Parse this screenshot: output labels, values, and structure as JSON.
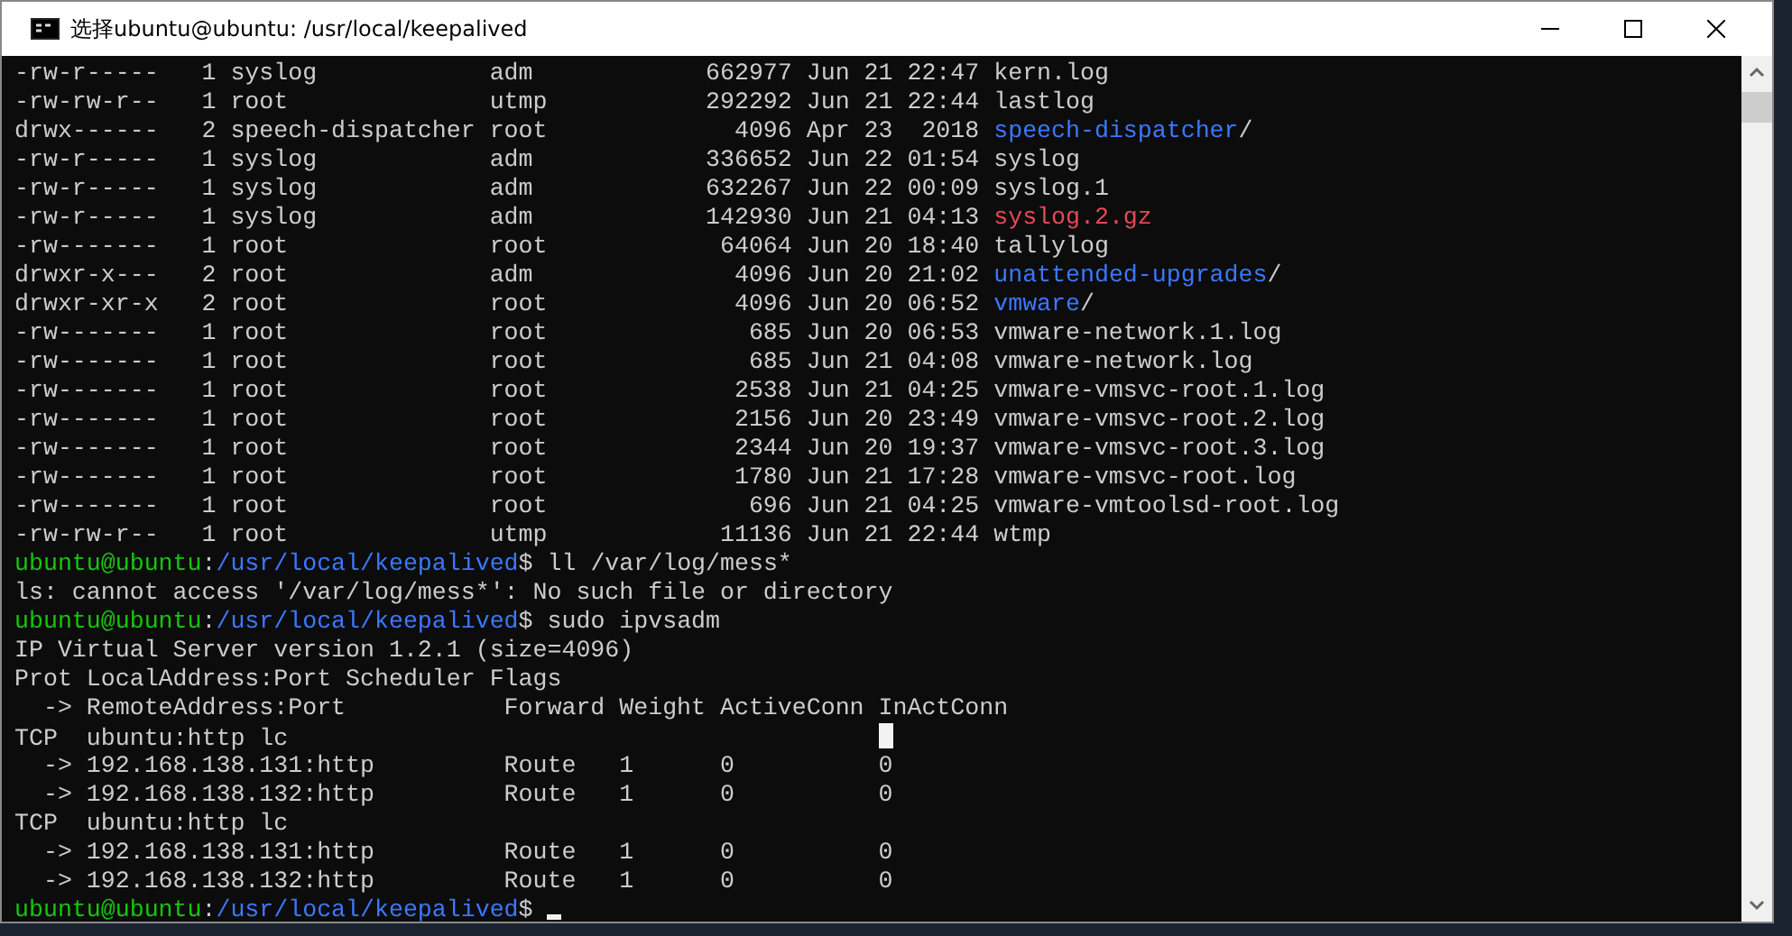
{
  "window": {
    "title": "选择ubuntu@ubuntu: /usr/local/keepalived"
  },
  "lines": [
    [
      {
        "kind": "plain",
        "text": "-rw-r-----   1 syslog            adm            662977 Jun 21 22:47 "
      },
      {
        "kind": "plain",
        "text": "kern.log"
      }
    ],
    [
      {
        "kind": "plain",
        "text": "-rw-rw-r--   1 root              utmp           292292 Jun 21 22:44 "
      },
      {
        "kind": "plain",
        "text": "lastlog"
      }
    ],
    [
      {
        "kind": "plain",
        "text": "drwx------   2 speech-dispatcher root             4096 Apr 23  2018 "
      },
      {
        "kind": "dir",
        "text": "speech-dispatcher"
      },
      {
        "kind": "plain",
        "text": "/"
      }
    ],
    [
      {
        "kind": "plain",
        "text": "-rw-r-----   1 syslog            adm            336652 Jun 22 01:54 "
      },
      {
        "kind": "plain",
        "text": "syslog"
      }
    ],
    [
      {
        "kind": "plain",
        "text": "-rw-r-----   1 syslog            adm            632267 Jun 22 00:09 "
      },
      {
        "kind": "plain",
        "text": "syslog.1"
      }
    ],
    [
      {
        "kind": "plain",
        "text": "-rw-r-----   1 syslog            adm            142930 Jun 21 04:13 "
      },
      {
        "kind": "archive",
        "text": "syslog.2.gz"
      }
    ],
    [
      {
        "kind": "plain",
        "text": "-rw-------   1 root              root            64064 Jun 20 18:40 "
      },
      {
        "kind": "plain",
        "text": "tallylog"
      }
    ],
    [
      {
        "kind": "plain",
        "text": "drwxr-x---   2 root              adm              4096 Jun 20 21:02 "
      },
      {
        "kind": "dir",
        "text": "unattended-upgrades"
      },
      {
        "kind": "plain",
        "text": "/"
      }
    ],
    [
      {
        "kind": "plain",
        "text": "drwxr-xr-x   2 root              root             4096 Jun 20 06:52 "
      },
      {
        "kind": "dir",
        "text": "vmware"
      },
      {
        "kind": "plain",
        "text": "/"
      }
    ],
    [
      {
        "kind": "plain",
        "text": "-rw-------   1 root              root              685 Jun 20 06:53 vmware-network.1.log"
      }
    ],
    [
      {
        "kind": "plain",
        "text": "-rw-------   1 root              root              685 Jun 21 04:08 vmware-network.log"
      }
    ],
    [
      {
        "kind": "plain",
        "text": "-rw-------   1 root              root             2538 Jun 21 04:25 vmware-vmsvc-root.1.log"
      }
    ],
    [
      {
        "kind": "plain",
        "text": "-rw-------   1 root              root             2156 Jun 20 23:49 vmware-vmsvc-root.2.log"
      }
    ],
    [
      {
        "kind": "plain",
        "text": "-rw-------   1 root              root             2344 Jun 20 19:37 vmware-vmsvc-root.3.log"
      }
    ],
    [
      {
        "kind": "plain",
        "text": "-rw-------   1 root              root             1780 Jun 21 17:28 vmware-vmsvc-root.log"
      }
    ],
    [
      {
        "kind": "plain",
        "text": "-rw-------   1 root              root              696 Jun 21 04:25 vmware-vmtoolsd-root.log"
      }
    ],
    [
      {
        "kind": "plain",
        "text": "-rw-rw-r--   1 root              utmp            11136 Jun 21 22:44 wtmp"
      }
    ],
    [
      {
        "kind": "user",
        "text": "ubuntu@ubuntu"
      },
      {
        "kind": "plain",
        "text": ":"
      },
      {
        "kind": "path",
        "text": "/usr/local/keepalived"
      },
      {
        "kind": "plain",
        "text": "$ ll /var/log/mess*"
      }
    ],
    [
      {
        "kind": "plain",
        "text": "ls: cannot access '/var/log/mess*': No such file or directory"
      }
    ],
    [
      {
        "kind": "user",
        "text": "ubuntu@ubuntu"
      },
      {
        "kind": "plain",
        "text": ":"
      },
      {
        "kind": "path",
        "text": "/usr/local/keepalived"
      },
      {
        "kind": "plain",
        "text": "$ sudo ipvsadm"
      }
    ],
    [
      {
        "kind": "plain",
        "text": "IP Virtual Server version 1.2.1 (size=4096)"
      }
    ],
    [
      {
        "kind": "plain",
        "text": "Prot LocalAddress:Port Scheduler Flags"
      }
    ],
    [
      {
        "kind": "plain",
        "text": "  -> RemoteAddress:Port           Forward Weight ActiveConn InActConn"
      }
    ],
    [
      {
        "kind": "plain",
        "text": "TCP  ubuntu:http lc                                         "
      },
      {
        "kind": "block-cursor"
      }
    ],
    [
      {
        "kind": "plain",
        "text": "  -> 192.168.138.131:http         Route   1      0          0"
      }
    ],
    [
      {
        "kind": "plain",
        "text": "  -> 192.168.138.132:http         Route   1      0          0"
      }
    ],
    [
      {
        "kind": "plain",
        "text": "TCP  ubuntu:http lc"
      }
    ],
    [
      {
        "kind": "plain",
        "text": "  -> 192.168.138.131:http         Route   1      0          0"
      }
    ],
    [
      {
        "kind": "plain",
        "text": "  -> 192.168.138.132:http         Route   1      0          0"
      }
    ],
    [
      {
        "kind": "user",
        "text": "ubuntu@ubuntu"
      },
      {
        "kind": "plain",
        "text": ":"
      },
      {
        "kind": "path",
        "text": "/usr/local/keepalived"
      },
      {
        "kind": "plain",
        "text": "$ "
      },
      {
        "kind": "underline-cursor"
      }
    ]
  ]
}
